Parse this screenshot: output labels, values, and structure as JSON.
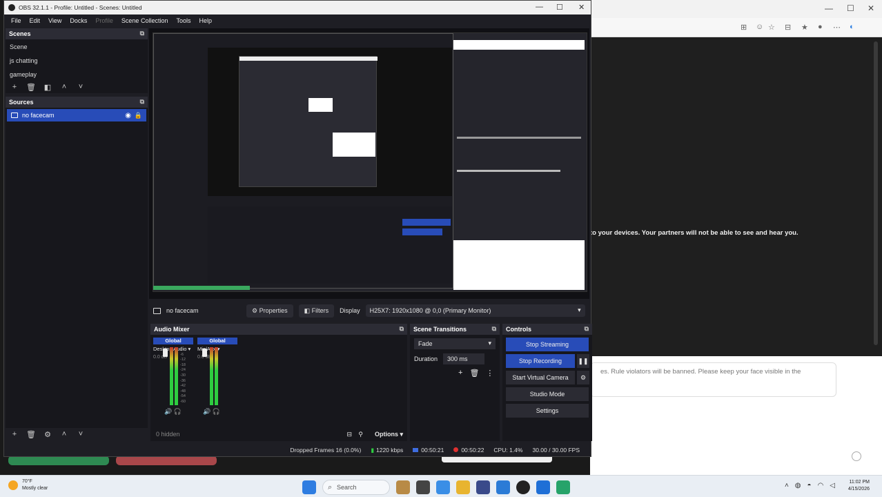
{
  "obs": {
    "window_title": "OBS 32.1.1 - Profile: Untitled - Scenes: Untitled",
    "window_controls": [
      "—",
      "☐",
      "✕"
    ],
    "menu": [
      "File",
      "Edit",
      "View",
      "Docks",
      "Profile",
      "Scene Collection",
      "Tools",
      "Help"
    ],
    "scenes": {
      "title": "Scenes",
      "items": [
        "Scene",
        "js chatting",
        "gameplay"
      ]
    },
    "sources": {
      "title": "Sources",
      "items": [
        "no facecam"
      ]
    },
    "source_toolbar": {
      "source_name": "no facecam",
      "properties": "Properties",
      "filters": "Filters",
      "display_label": "Display",
      "display_value": "H25X7: 1920x1080 @ 0,0 (Primary Monitor)"
    },
    "audio_mixer": {
      "title": "Audio Mixer",
      "channels": [
        {
          "head": "Global",
          "name": "Desktop Audio",
          "db": "0.0 dB"
        },
        {
          "head": "Global",
          "name": "Mic/Aux",
          "db": "0.0 dB"
        }
      ],
      "scale": [
        "0",
        "-6",
        "-12",
        "-18",
        "-24",
        "-30",
        "-36",
        "-42",
        "-48",
        "-54",
        "-60"
      ],
      "hidden": "0 hidden",
      "options": "Options"
    },
    "transitions": {
      "title": "Scene Transitions",
      "type": "Fade",
      "duration_label": "Duration",
      "duration_value": "300 ms"
    },
    "controls": {
      "title": "Controls",
      "stop_streaming": "Stop Streaming",
      "stop_recording": "Stop Recording",
      "start_virtual_camera": "Start Virtual Camera",
      "studio_mode": "Studio Mode",
      "settings": "Settings"
    },
    "status": {
      "dropped_frames": "Dropped Frames 16 (0.0%)",
      "bitrate": "1220 kbps",
      "stream_time": "00:50:21",
      "rec_time": "00:50:22",
      "cpu": "CPU: 1.4%",
      "fps": "30.00 / 30.00 FPS"
    }
  },
  "browser": {
    "notice": "to your devices. Your partners will not be able to see and hear you.",
    "rule_text": "es. Rule violators will be banned. Please keep your face visible in the"
  },
  "taskbar": {
    "weather_temp": "70°F",
    "weather_desc": "Mostly clear",
    "search": "Search",
    "time": "11:02 PM",
    "date": "4/15/2026"
  },
  "colors": {
    "accent_blue": "#284cb8",
    "meter_green": "#2ecc40",
    "panel_bg": "#17171c"
  }
}
